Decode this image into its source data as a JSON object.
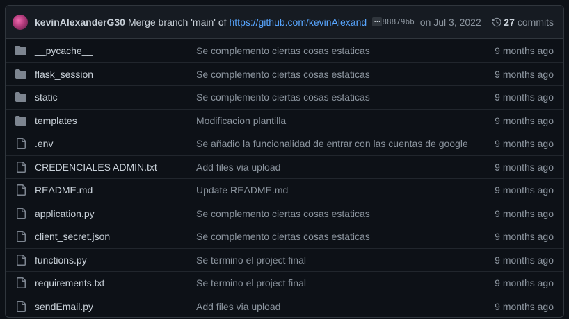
{
  "commit": {
    "author": "kevinAlexanderG30",
    "message": "Merge branch 'main' of",
    "link": "https://github.com/kevinAlexanderG30/...",
    "ellipsis": "…",
    "sha": "88879bb",
    "date": "on Jul 3, 2022",
    "commits_count": "27",
    "commits_label": "commits"
  },
  "colors": {
    "background": "#0d1117",
    "header_bg": "#161b22",
    "border": "#30363d",
    "folder_icon": "#7d8590",
    "link": "#58a6ff"
  },
  "files": [
    {
      "type": "folder",
      "icon": "folder-icon",
      "name": "__pycache__",
      "message": "Se complemento ciertas cosas estaticas",
      "age": "9 months ago"
    },
    {
      "type": "folder",
      "icon": "folder-icon",
      "name": "flask_session",
      "message": "Se complemento ciertas cosas estaticas",
      "age": "9 months ago"
    },
    {
      "type": "folder",
      "icon": "folder-icon",
      "name": "static",
      "message": "Se complemento ciertas cosas estaticas",
      "age": "9 months ago"
    },
    {
      "type": "folder",
      "icon": "folder-icon",
      "name": "templates",
      "message": "Modificacion plantilla",
      "age": "9 months ago"
    },
    {
      "type": "file",
      "icon": "file-icon",
      "name": ".env",
      "message": "Se añadio la funcionalidad de entrar con las cuentas de google",
      "age": "9 months ago"
    },
    {
      "type": "file",
      "icon": "file-icon",
      "name": "CREDENCIALES ADMIN.txt",
      "message": "Add files via upload",
      "age": "9 months ago"
    },
    {
      "type": "file",
      "icon": "file-icon",
      "name": "README.md",
      "message": "Update README.md",
      "age": "9 months ago"
    },
    {
      "type": "file",
      "icon": "file-icon",
      "name": "application.py",
      "message": "Se complemento ciertas cosas estaticas",
      "age": "9 months ago"
    },
    {
      "type": "file",
      "icon": "file-icon",
      "name": "client_secret.json",
      "message": "Se complemento ciertas cosas estaticas",
      "age": "9 months ago"
    },
    {
      "type": "file",
      "icon": "file-icon",
      "name": "functions.py",
      "message": "Se termino el project final",
      "age": "9 months ago"
    },
    {
      "type": "file",
      "icon": "file-icon",
      "name": "requirements.txt",
      "message": "Se termino el project final",
      "age": "9 months ago"
    },
    {
      "type": "file",
      "icon": "file-icon",
      "name": "sendEmail.py",
      "message": "Add files via upload",
      "age": "9 months ago"
    }
  ]
}
